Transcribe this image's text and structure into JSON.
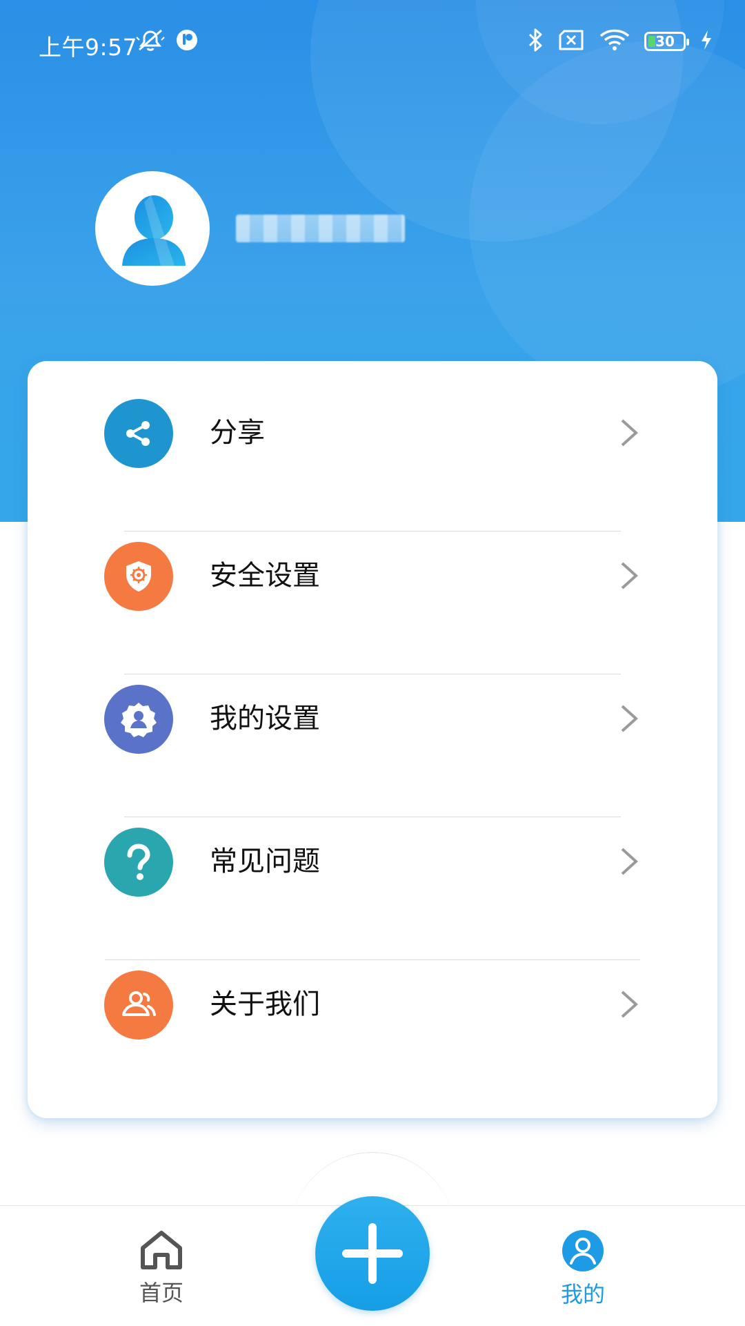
{
  "status_bar": {
    "time": "上午9:57",
    "battery_level": "30",
    "icons": [
      "mute-icon",
      "app-notification-icon",
      "bluetooth-icon",
      "sim-off-icon",
      "wifi-icon",
      "battery-icon",
      "charging-icon"
    ]
  },
  "profile": {
    "avatar_icon": "user-avatar-icon"
  },
  "menu": {
    "items": [
      {
        "label": "分享",
        "icon": "share-icon",
        "color": "#1f95cf"
      },
      {
        "label": "安全设置",
        "icon": "security-shield-icon",
        "color": "#f47a42"
      },
      {
        "label": "我的设置",
        "icon": "user-settings-icon",
        "color": "#5a72c8"
      },
      {
        "label": "常见问题",
        "icon": "question-icon",
        "color": "#2aa6ae"
      },
      {
        "label": "关于我们",
        "icon": "team-icon",
        "color": "#f47a42"
      }
    ]
  },
  "bottom_nav": {
    "home_label": "首页",
    "mine_label": "我的",
    "add_icon": "plus-icon",
    "active": "我的"
  },
  "colors": {
    "header_blue": "#2a8fe6",
    "accent_blue": "#1d9be4"
  }
}
